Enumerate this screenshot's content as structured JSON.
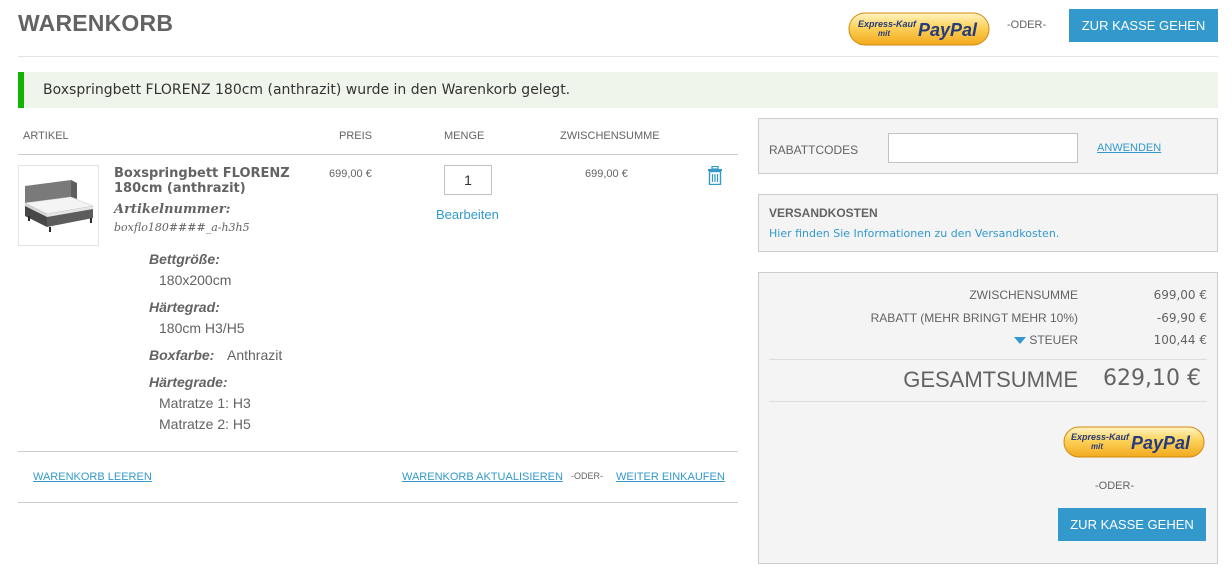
{
  "header": {
    "title": "WARENKORB",
    "paypal_line1": "Express-Kauf",
    "paypal_line2": "mit",
    "paypal_brand": "PayPal",
    "or_text": "-ODER-",
    "checkout_label": "ZUR KASSE GEHEN"
  },
  "message": {
    "text": "Boxspringbett FLORENZ 180cm (anthrazit) wurde in den Warenkorb gelegt.",
    "accent_color": "#11b400",
    "background_color": "#eff5ea"
  },
  "table": {
    "headers": {
      "article": "ARTIKEL",
      "price": "PREIS",
      "quantity": "MENGE",
      "subtotal": "ZWISCHENSUMME"
    }
  },
  "item": {
    "name": "Boxspringbett FLORENZ 180cm (anthrazit)",
    "sku_label": "Artikelnummer:",
    "sku": "boxflo180####_a-h3h5",
    "options": [
      {
        "label": "Bettgröße:",
        "value": "180x200cm"
      },
      {
        "label": "Härtegrad:",
        "value": "180cm H3/H5"
      },
      {
        "label": "Boxfarbe:",
        "value": "Anthrazit"
      },
      {
        "label": "Härtegrade:",
        "values": [
          "Matratze 1: H3",
          "Matratze 2: H5"
        ]
      }
    ],
    "price": "699,00 €",
    "quantity": "1",
    "edit_label": "Bearbeiten",
    "subtotal": "699,00 €",
    "delete_icon": "trash-icon"
  },
  "cart_actions": {
    "clear_label": "WARENKORB LEEREN",
    "update_label": "WARENKORB AKTUALISIEREN",
    "or_text": "-ODER-",
    "continue_label": "WEITER EINKAUFEN"
  },
  "discount": {
    "label": "RABATTCODES",
    "input_value": "",
    "apply_label": "ANWENDEN"
  },
  "shipping": {
    "title": "VERSANDKOSTEN",
    "link_text": "Hier finden Sie Informationen zu den Versandkosten."
  },
  "totals": {
    "subtotal_label": "ZWISCHENSUMME",
    "subtotal_value": "699,00 €",
    "discount_label": "RABATT (MEHR BRINGT MEHR 10%)",
    "discount_value": "-69,90 €",
    "tax_label": "STEUER",
    "tax_value": "100,44 €",
    "grand_label": "GESAMTSUMME",
    "grand_value": "629,10 €",
    "paypal_line1": "Express-Kauf",
    "paypal_line2": "mit",
    "paypal_brand": "PayPal",
    "or_text": "-ODER-",
    "checkout_label": "ZUR KASSE GEHEN"
  },
  "colors": {
    "accent_blue": "#3399cc",
    "text_gray": "#636363",
    "paypal_yellow": "#f9b429",
    "paypal_blue": "#253b80"
  }
}
